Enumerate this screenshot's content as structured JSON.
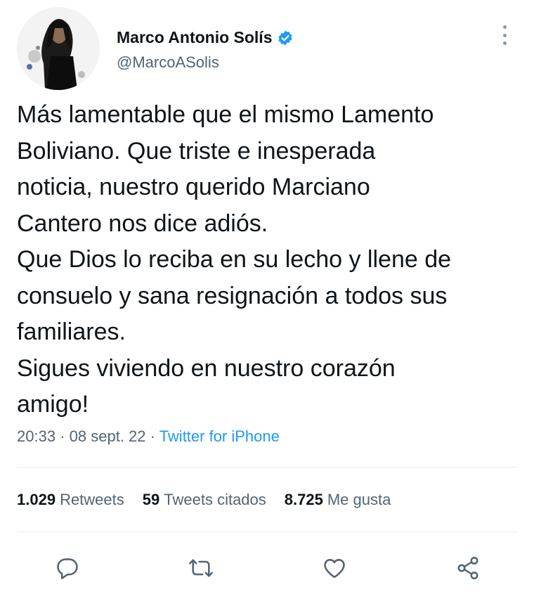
{
  "author": {
    "name": "Marco Antonio Solís",
    "handle": "@MarcoASolis",
    "verified": true
  },
  "tweet": {
    "text": "Más lamentable que el mismo Lamento\nBoliviano. Que triste e inesperada\nnoticia, nuestro querido Marciano\nCantero nos dice adiós.\nQue Dios lo reciba en su lecho y llene de\nconsuelo y sana resignación a todos sus\nfamiliares.\nSigues viviendo en nuestro corazón\namigo!",
    "time": "20:33",
    "date": "08 sept. 22",
    "separator": "·",
    "source": "Twitter for iPhone"
  },
  "stats": {
    "retweets_count": "1.029",
    "retweets_label": "Retweets",
    "quotes_count": "59",
    "quotes_label": "Tweets citados",
    "likes_count": "8.725",
    "likes_label": "Me gusta"
  },
  "colors": {
    "accent": "#1d9bf0",
    "secondary_text": "#536471",
    "icon": "#536471"
  },
  "icons": [
    "more-icon",
    "verified-badge-icon",
    "reply-icon",
    "retweet-icon",
    "like-icon",
    "share-icon"
  ]
}
